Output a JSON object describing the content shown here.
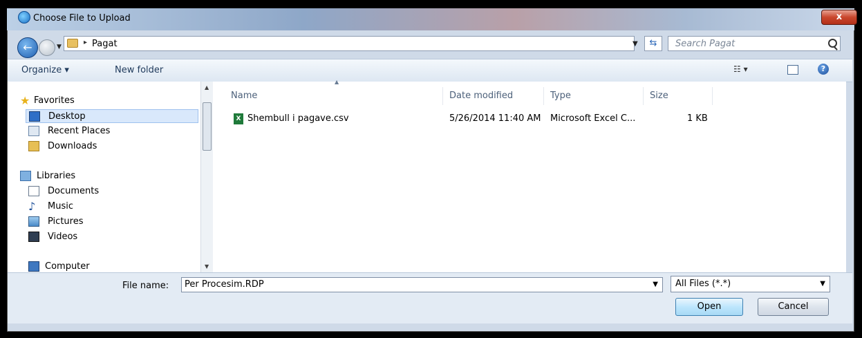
{
  "window": {
    "title": "Choose File to Upload",
    "close_glyph": "x"
  },
  "address": {
    "separator": "▸",
    "path": "Pagat",
    "search_placeholder": "Search Pagat"
  },
  "toolbar": {
    "organize": "Organize ▾",
    "new_folder": "New folder",
    "view_glyph": "☷ ▾",
    "help_glyph": "?"
  },
  "nav": {
    "favorites": [
      {
        "label": "Favorites",
        "icon": "star-icon"
      },
      {
        "label": "Desktop",
        "icon": "desktop-icon",
        "selected": true
      },
      {
        "label": "Recent Places",
        "icon": "recent-places-icon"
      },
      {
        "label": "Downloads",
        "icon": "downloads-folder-icon"
      }
    ],
    "libraries": [
      {
        "label": "Libraries",
        "icon": "libraries-icon"
      },
      {
        "label": "Documents",
        "icon": "documents-icon"
      },
      {
        "label": "Music",
        "icon": "music-icon"
      },
      {
        "label": "Pictures",
        "icon": "pictures-icon"
      },
      {
        "label": "Videos",
        "icon": "videos-icon"
      }
    ],
    "computer": {
      "label": "Computer",
      "icon": "computer-icon"
    }
  },
  "files": {
    "columns": [
      "Name",
      "Date modified",
      "Type",
      "Size"
    ],
    "rows": [
      {
        "name": "Shembull i pagave.csv",
        "date": "5/26/2014 11:40 AM",
        "type": "Microsoft Excel C...",
        "size": "1 KB",
        "icon": "excel-file-icon"
      }
    ]
  },
  "footer": {
    "file_name_label": "File name:",
    "file_name_value": "Per Procesim.RDP",
    "file_type_value": "All Files (*.*)",
    "open_label": "Open",
    "cancel_label": "Cancel"
  },
  "colors": {
    "accent": "#3c7fb1",
    "selection": "#d9e8fb",
    "chrome": "#cfdae8"
  }
}
